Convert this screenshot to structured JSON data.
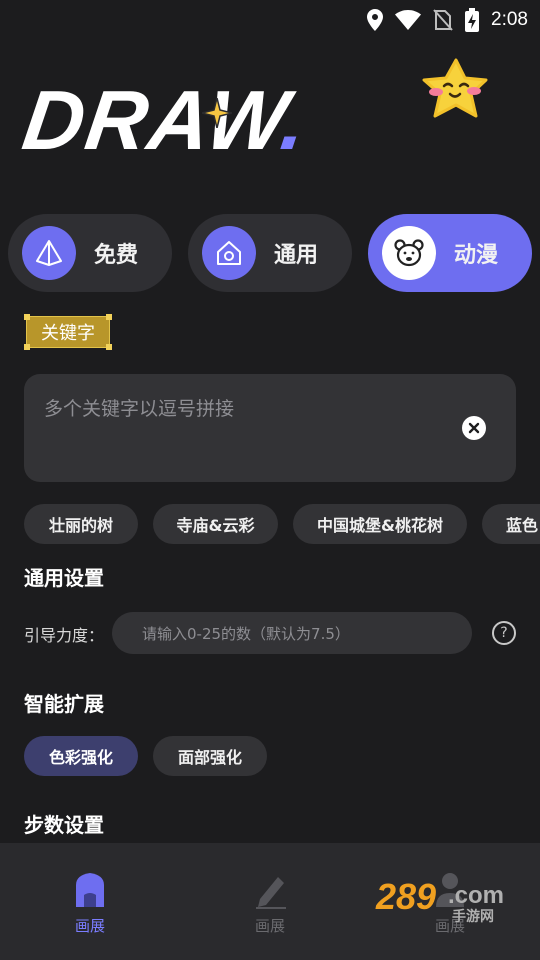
{
  "status_bar": {
    "time": "2:08",
    "icons": [
      "location-icon",
      "wifi-icon",
      "no-sim-icon",
      "battery-charging-icon"
    ]
  },
  "logo": {
    "text": "DRAW",
    "dot": "."
  },
  "categories": [
    {
      "label": "免费",
      "icon": "pyramid-icon",
      "active": false
    },
    {
      "label": "通用",
      "icon": "home-icon",
      "active": false
    },
    {
      "label": "动漫",
      "icon": "bear-icon",
      "active": true
    }
  ],
  "keywords": {
    "tag_label": "关键字",
    "placeholder": "多个关键字以逗号拼接"
  },
  "suggestions": [
    "壮丽的树",
    "寺庙&云彩",
    "中国城堡&桃花树",
    "蓝色"
  ],
  "general_settings": {
    "title": "通用设置",
    "guide_label": "引导力度：",
    "guide_placeholder": "请输入0-25的数（默认为7.5）",
    "help": "?"
  },
  "smart_extend": {
    "title": "智能扩展",
    "options": [
      {
        "label": "色彩强化",
        "selected": true
      },
      {
        "label": "面部强化",
        "selected": false
      }
    ]
  },
  "steps": {
    "title": "步数设置"
  },
  "bottom_nav": [
    {
      "label": "画展",
      "icon": "gallery-home-icon",
      "active": true
    },
    {
      "label": "画展",
      "icon": "pencil-icon",
      "active": false
    },
    {
      "label": "画展",
      "icon": "profile-icon",
      "active": false
    }
  ],
  "watermark": {
    "number": "289",
    "domain": ".com",
    "text": "手游网"
  },
  "colors": {
    "accent": "#6e6ef0",
    "background": "#1c1c1e",
    "chip": "#333336",
    "keyword_tag": "#b8962a"
  }
}
